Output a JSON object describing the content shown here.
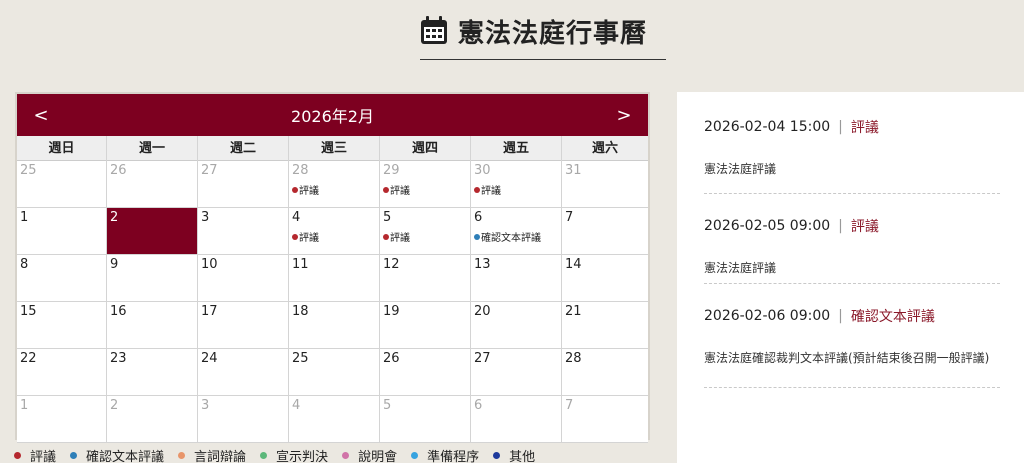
{
  "page": {
    "title": "憲法法庭行事曆",
    "icon": "calendar-icon"
  },
  "colors": {
    "accent": "#7d0020",
    "review": "#b5282e",
    "confirm": "#2e7fb8",
    "argument": "#e8956a",
    "judgment": "#5cb87a",
    "briefing": "#d173a8",
    "preparation": "#36a3e0",
    "other": "#1e3a9c"
  },
  "calendar": {
    "month_label": "2026年2月",
    "prev_label": "<",
    "next_label": ">",
    "weekdays": [
      "週日",
      "週一",
      "週二",
      "週三",
      "週四",
      "週五",
      "週六"
    ],
    "weeks": [
      [
        {
          "day": "25",
          "muted": true,
          "today": false,
          "events": []
        },
        {
          "day": "26",
          "muted": true,
          "today": false,
          "events": []
        },
        {
          "day": "27",
          "muted": true,
          "today": false,
          "events": []
        },
        {
          "day": "28",
          "muted": true,
          "today": false,
          "events": [
            {
              "label": "評議",
              "color": "#b5282e"
            }
          ]
        },
        {
          "day": "29",
          "muted": true,
          "today": false,
          "events": [
            {
              "label": "評議",
              "color": "#b5282e"
            }
          ]
        },
        {
          "day": "30",
          "muted": true,
          "today": false,
          "events": [
            {
              "label": "評議",
              "color": "#b5282e"
            }
          ]
        },
        {
          "day": "31",
          "muted": true,
          "today": false,
          "events": []
        }
      ],
      [
        {
          "day": "1",
          "muted": false,
          "today": false,
          "events": []
        },
        {
          "day": "2",
          "muted": false,
          "today": true,
          "events": []
        },
        {
          "day": "3",
          "muted": false,
          "today": false,
          "events": []
        },
        {
          "day": "4",
          "muted": false,
          "today": false,
          "events": [
            {
              "label": "評議",
              "color": "#b5282e"
            }
          ]
        },
        {
          "day": "5",
          "muted": false,
          "today": false,
          "events": [
            {
              "label": "評議",
              "color": "#b5282e"
            }
          ]
        },
        {
          "day": "6",
          "muted": false,
          "today": false,
          "events": [
            {
              "label": "確認文本評議",
              "color": "#2e7fb8"
            }
          ]
        },
        {
          "day": "7",
          "muted": false,
          "today": false,
          "events": []
        }
      ],
      [
        {
          "day": "8",
          "muted": false,
          "today": false,
          "events": []
        },
        {
          "day": "9",
          "muted": false,
          "today": false,
          "events": []
        },
        {
          "day": "10",
          "muted": false,
          "today": false,
          "events": []
        },
        {
          "day": "11",
          "muted": false,
          "today": false,
          "events": []
        },
        {
          "day": "12",
          "muted": false,
          "today": false,
          "events": []
        },
        {
          "day": "13",
          "muted": false,
          "today": false,
          "events": []
        },
        {
          "day": "14",
          "muted": false,
          "today": false,
          "events": []
        }
      ],
      [
        {
          "day": "15",
          "muted": false,
          "today": false,
          "events": []
        },
        {
          "day": "16",
          "muted": false,
          "today": false,
          "events": []
        },
        {
          "day": "17",
          "muted": false,
          "today": false,
          "events": []
        },
        {
          "day": "18",
          "muted": false,
          "today": false,
          "events": []
        },
        {
          "day": "19",
          "muted": false,
          "today": false,
          "events": []
        },
        {
          "day": "20",
          "muted": false,
          "today": false,
          "events": []
        },
        {
          "day": "21",
          "muted": false,
          "today": false,
          "events": []
        }
      ],
      [
        {
          "day": "22",
          "muted": false,
          "today": false,
          "events": []
        },
        {
          "day": "23",
          "muted": false,
          "today": false,
          "events": []
        },
        {
          "day": "24",
          "muted": false,
          "today": false,
          "events": []
        },
        {
          "day": "25",
          "muted": false,
          "today": false,
          "events": []
        },
        {
          "day": "26",
          "muted": false,
          "today": false,
          "events": []
        },
        {
          "day": "27",
          "muted": false,
          "today": false,
          "events": []
        },
        {
          "day": "28",
          "muted": false,
          "today": false,
          "events": []
        }
      ],
      [
        {
          "day": "1",
          "muted": true,
          "today": false,
          "events": []
        },
        {
          "day": "2",
          "muted": true,
          "today": false,
          "events": []
        },
        {
          "day": "3",
          "muted": true,
          "today": false,
          "events": []
        },
        {
          "day": "4",
          "muted": true,
          "today": false,
          "events": []
        },
        {
          "day": "5",
          "muted": true,
          "today": false,
          "events": []
        },
        {
          "day": "6",
          "muted": true,
          "today": false,
          "events": []
        },
        {
          "day": "7",
          "muted": true,
          "today": false,
          "events": []
        }
      ]
    ]
  },
  "legend": [
    {
      "label": "評議",
      "color": "#b5282e"
    },
    {
      "label": "確認文本評議",
      "color": "#2e7fb8"
    },
    {
      "label": "言詞辯論",
      "color": "#e8956a"
    },
    {
      "label": "宣示判決",
      "color": "#5cb87a"
    },
    {
      "label": "說明會",
      "color": "#d173a8"
    },
    {
      "label": "準備程序",
      "color": "#36a3e0"
    },
    {
      "label": "其他",
      "color": "#1e3a9c"
    }
  ],
  "events": [
    {
      "datetime": "2026-02-04 15:00",
      "separator": "|",
      "type": "評議",
      "description": "憲法法庭評議"
    },
    {
      "datetime": "2026-02-05 09:00",
      "separator": "|",
      "type": "評議",
      "description": "憲法法庭評議"
    },
    {
      "datetime": "2026-02-06 09:00",
      "separator": "|",
      "type": "確認文本評議",
      "description": "憲法法庭確認裁判文本評議(預計結束後召開一般評議)"
    }
  ]
}
